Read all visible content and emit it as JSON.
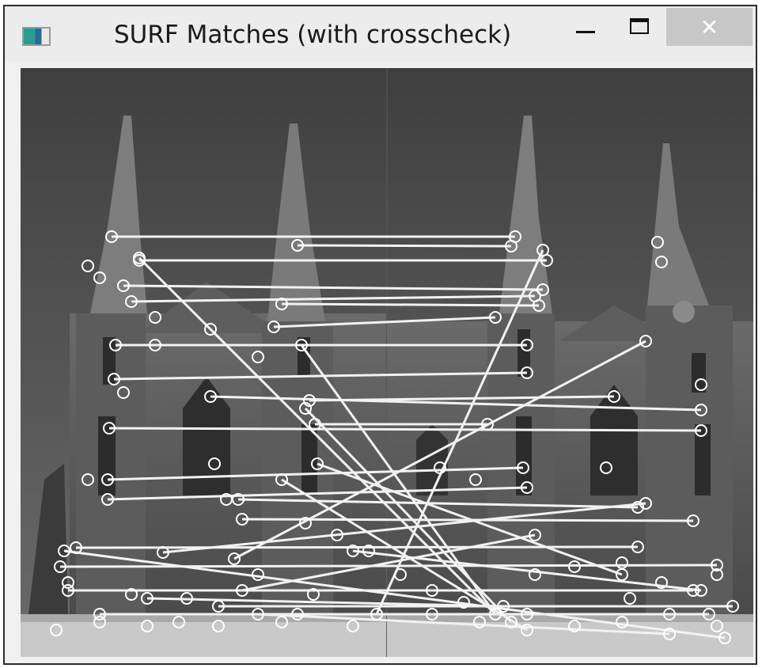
{
  "window": {
    "title": "SURF Matches (with crosscheck)",
    "icon": "opencv-window-icon",
    "controls": {
      "minimize_icon": "minimize-icon",
      "maximize_icon": "maximize-icon",
      "close_icon": "close-icon",
      "close_glyph": "✕"
    }
  },
  "image": {
    "description_icon": "feature-match-image",
    "style": "grayscale"
  }
}
